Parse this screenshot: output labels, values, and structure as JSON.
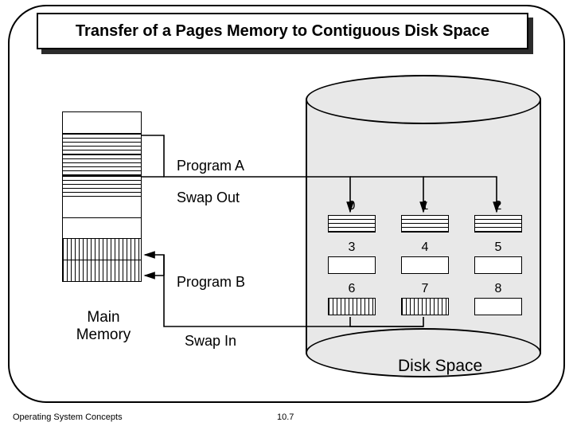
{
  "title": "Transfer of a Pages Memory to Contiguous Disk Space",
  "labels": {
    "programA": "Program A",
    "swapOut": "Swap Out",
    "programB": "Program B",
    "swapIn": "Swap In",
    "mainMemory": "Main\nMemory",
    "diskSpace": "Disk Space"
  },
  "diskSlots": [
    {
      "num": "0",
      "fill": "hatchH"
    },
    {
      "num": "1",
      "fill": "hatchH"
    },
    {
      "num": "2",
      "fill": "hatchH"
    },
    {
      "num": "3",
      "fill": "empty"
    },
    {
      "num": "4",
      "fill": "empty"
    },
    {
      "num": "5",
      "fill": "empty"
    },
    {
      "num": "6",
      "fill": "hatchV"
    },
    {
      "num": "7",
      "fill": "hatchV"
    },
    {
      "num": "8",
      "fill": "empty"
    }
  ],
  "memorySlots": [
    {
      "fill": "empty"
    },
    {
      "fill": "hatchH"
    },
    {
      "fill": "hatchH"
    },
    {
      "fill": "hatchH"
    },
    {
      "fill": "empty"
    },
    {
      "fill": "empty"
    },
    {
      "fill": "hatchV"
    },
    {
      "fill": "hatchV"
    }
  ],
  "footer": {
    "left": "Operating System Concepts",
    "center": "10.7"
  }
}
